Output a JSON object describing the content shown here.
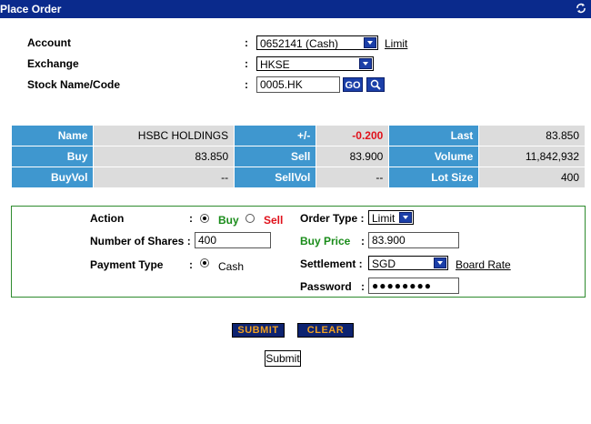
{
  "window": {
    "title": "Place Order",
    "refresh_icon": "refresh-icon"
  },
  "header": {
    "account_label": "Account",
    "account_value": "0652141 (Cash)",
    "limit_link": "Limit",
    "exchange_label": "Exchange",
    "exchange_value": "HKSE",
    "stock_label": "Stock Name/Code",
    "stock_value": "0005.HK",
    "go_label": "GO",
    "colon": ":"
  },
  "quote": {
    "rows": [
      [
        {
          "h": "Name"
        },
        {
          "v": "HSBC HOLDINGS"
        },
        {
          "h": "+/-"
        },
        {
          "v": "-0.200",
          "red": true
        },
        {
          "h": "Last"
        },
        {
          "v": "83.850"
        }
      ],
      [
        {
          "h": "Buy"
        },
        {
          "v": "83.850"
        },
        {
          "h": "Sell"
        },
        {
          "v": "83.900"
        },
        {
          "h": "Volume"
        },
        {
          "v": "11,842,932"
        }
      ],
      [
        {
          "h": "BuyVol"
        },
        {
          "v": "--"
        },
        {
          "h": "SellVol"
        },
        {
          "v": "--"
        },
        {
          "h": "Lot Size"
        },
        {
          "v": "400"
        }
      ]
    ]
  },
  "order": {
    "action_label": "Action",
    "buy_label": "Buy",
    "sell_label": "Sell",
    "shares_label": "Number of Shares :",
    "shares_value": "400",
    "payment_label": "Payment Type",
    "cash_label": "Cash",
    "order_type_label": "Order Type :",
    "order_type_value": "Limit",
    "buy_price_label": "Buy Price",
    "buy_price_value": "83.900",
    "settlement_label": "Settlement :",
    "settlement_value": "SGD",
    "board_rate_link": "Board Rate",
    "password_label": "Password",
    "password_value": "●●●●●●●●",
    "colon": ":"
  },
  "buttons": {
    "submit": "SUBMIT",
    "clear": "CLEAR",
    "submit_plain": "Submit"
  },
  "colors": {
    "titlebar": "#0a2a8c",
    "header_cell": "#3f97cf",
    "value_cell": "#dcdcdc",
    "negative": "#e0101a",
    "positive": "#1a8c1a"
  }
}
